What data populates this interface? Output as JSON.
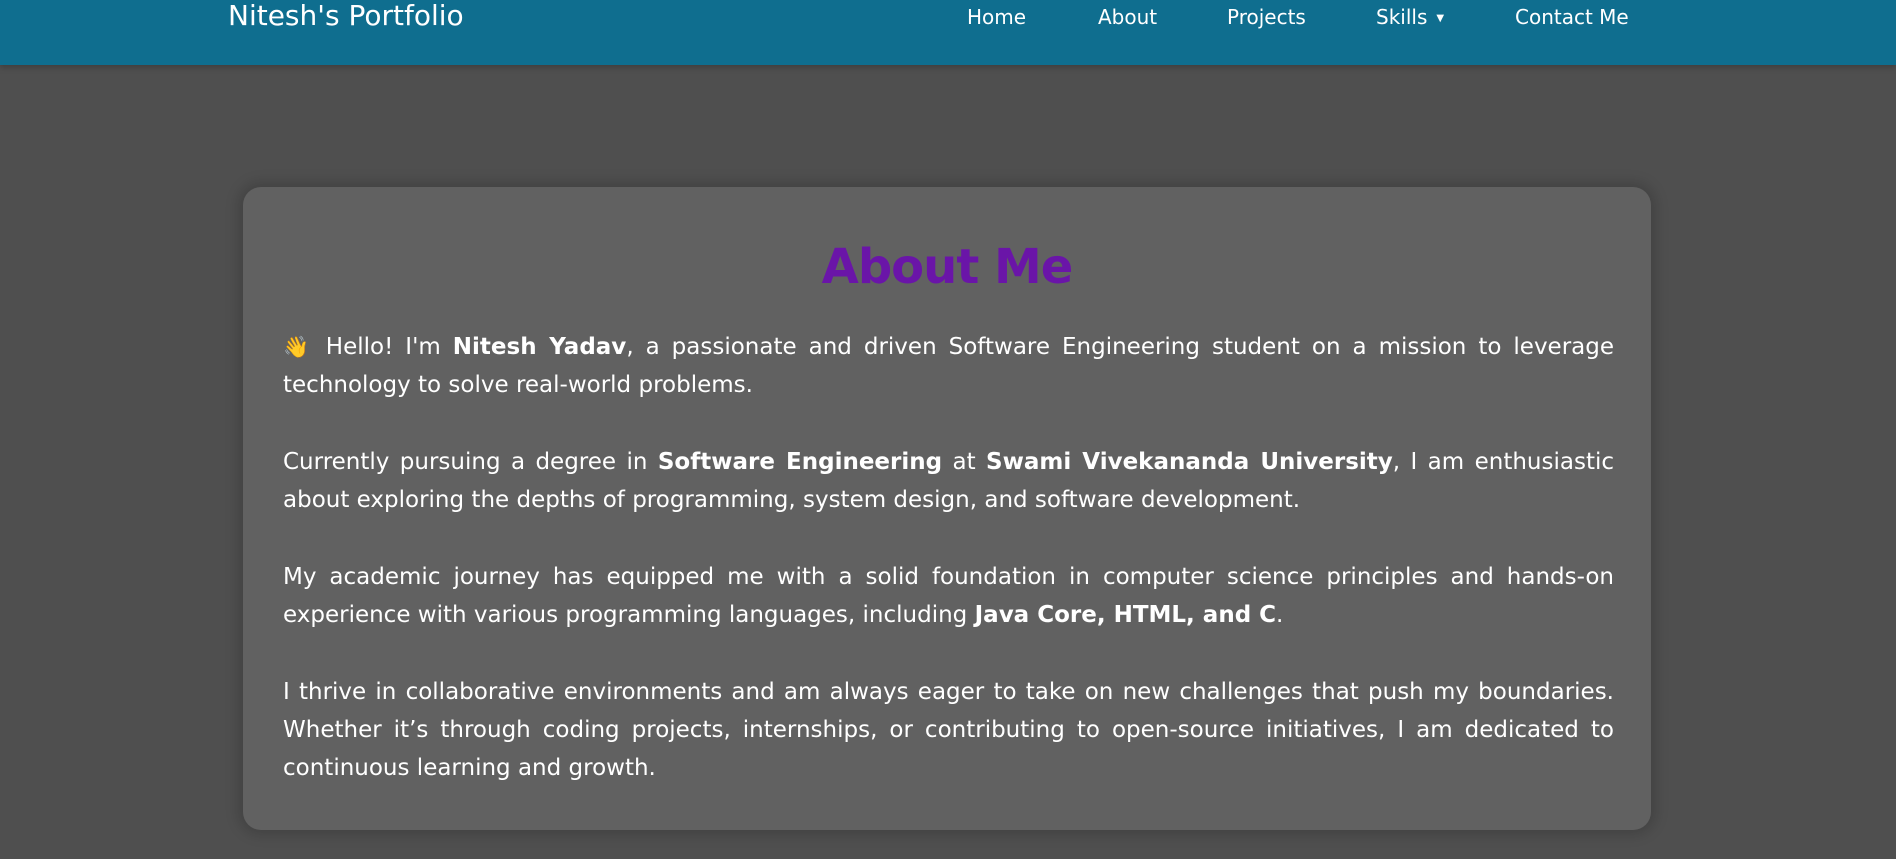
{
  "nav": {
    "brand": "Nitesh's Portfolio",
    "items": [
      {
        "label": "Home"
      },
      {
        "label": "About"
      },
      {
        "label": "Projects"
      },
      {
        "label": "Skills",
        "caret": "▼"
      },
      {
        "label": "Contact Me"
      }
    ]
  },
  "about": {
    "title": "About Me",
    "p1": {
      "wave": "👋",
      "pre": " Hello! I'm ",
      "name": "Nitesh Yadav",
      "post": ", a passionate and driven Software Engineering student on a mission to leverage technology to solve real-world problems."
    },
    "p2": {
      "pre": "Currently pursuing a degree in ",
      "degree": "Software Engineering",
      "mid": " at ",
      "university": "Swami Vivekananda University",
      "post": ", I am enthusiastic about exploring the depths of programming, system design, and software development."
    },
    "p3": {
      "pre": "My academic journey has equipped me with a solid foundation in computer science principles and hands-on experience with various programming languages, including ",
      "languages": "Java Core, HTML, and C",
      "post": "."
    },
    "p4": {
      "text": "I thrive in collaborative environments and am always eager to take on new challenges that push my boundaries. Whether it’s through coding projects, internships, or contributing to open-source initiatives, I am dedicated to continuous learning and growth."
    }
  },
  "colors": {
    "navbar": "#0f6e8f",
    "background": "#4f4f4f",
    "card": "#616161",
    "title": "#6a15a8"
  }
}
